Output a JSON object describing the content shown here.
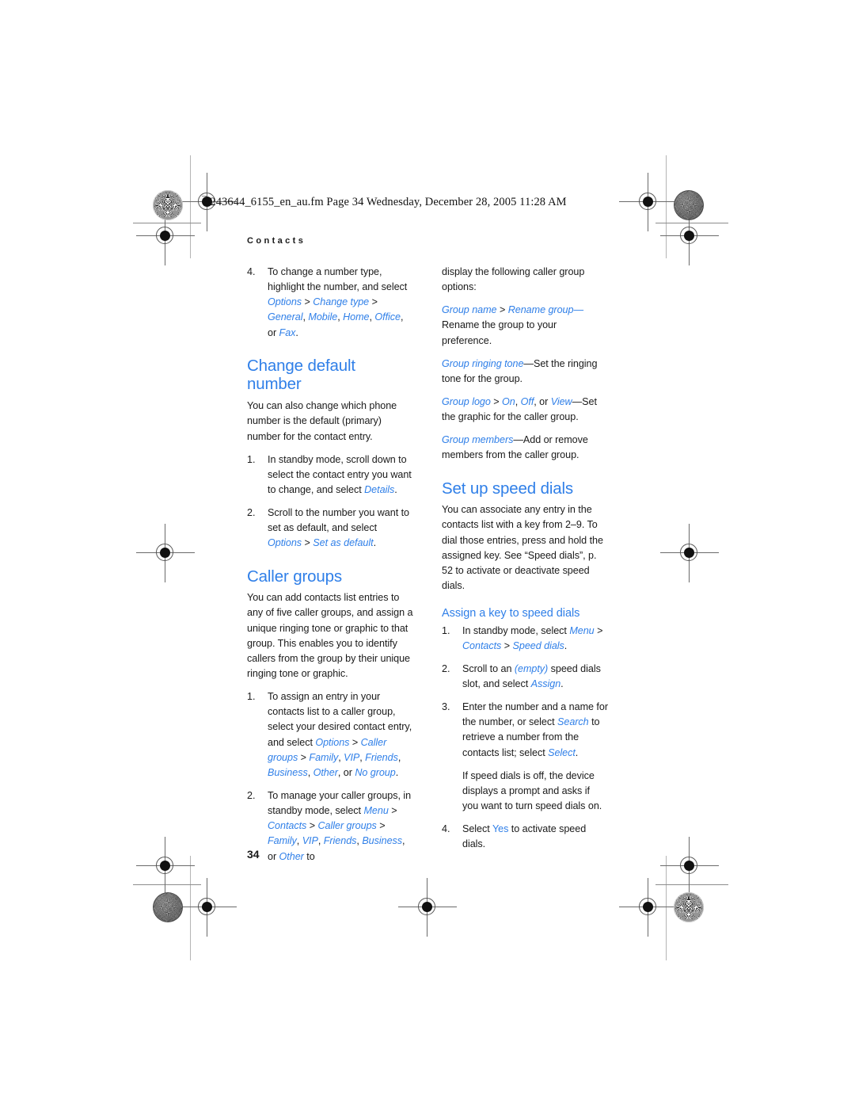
{
  "page": {
    "filename_line": "9243644_6155_en_au.fm  Page 34  Wednesday, December 28, 2005  11:28 AM",
    "running_head": "Contacts",
    "page_number": "34",
    "accent_color": "#2f7fe8",
    "text_color": "#1a1a1a"
  },
  "left_column": {
    "step4": {
      "num": "4.",
      "t1": "To change a number type, highlight the number, and select ",
      "ui1": "Options",
      "sep1": " > ",
      "ui2": "Change type",
      "sep2": " > ",
      "ui3": "General",
      "c1": ", ",
      "ui4": "Mobile",
      "c2": ", ",
      "ui5": "Home",
      "c3": ", ",
      "ui6": "Office",
      "c4": ", or ",
      "ui7": "Fax",
      "end": "."
    },
    "heading_change_default": "Change default number",
    "change_default_intro": "You can also change which phone number is the default (primary) number for the contact entry.",
    "cd_step1": {
      "num": "1.",
      "t1": "In standby mode, scroll down to select the contact entry you want to change, and select ",
      "ui1": "Details",
      "end": "."
    },
    "cd_step2": {
      "num": "2.",
      "t1": "Scroll to the number you want to set as default, and select ",
      "ui1": "Options",
      "sep1": " > ",
      "ui2": "Set as default",
      "end": "."
    },
    "heading_caller_groups": "Caller groups",
    "caller_groups_intro": "You can add contacts list entries to any of five caller groups, and assign a unique ringing tone or graphic to that group. This enables you to identify callers from the group by their unique ringing tone or graphic.",
    "cg_step1": {
      "num": "1.",
      "t1": "To assign an entry in your contacts list to a caller group, select your desired contact entry, and select ",
      "ui1": "Options",
      "sep1": " > ",
      "ui2": "Caller groups",
      "sep2": " > ",
      "ui3": "Family",
      "c1": ", ",
      "ui4": "VIP",
      "c2": ", ",
      "ui5": "Friends",
      "c3": ", ",
      "ui6": "Business",
      "c4": ", ",
      "ui7": "Other",
      "c5": ", or ",
      "ui8": "No group",
      "end": "."
    },
    "cg_step2": {
      "num": "2.",
      "t1": "To manage your caller groups, in standby mode, select ",
      "ui1": "Menu",
      "sep1": " > ",
      "ui2": "Contacts",
      "sep2": " > ",
      "ui3": "Caller groups",
      "sep3": " > ",
      "ui4": "Family",
      "c1": ", ",
      "ui5": "VIP",
      "c2": ", ",
      "ui6": "Friends",
      "c3": ", ",
      "ui7": "Business",
      "c4": ", or ",
      "ui8": "Other",
      "end": " to"
    }
  },
  "right_column": {
    "continuation": "display the following caller group options:",
    "opt_group_name": {
      "ui1": "Group name",
      "sep1": " > ",
      "ui2": "Rename group",
      "dash": "—",
      "t1": "Rename the group to your preference."
    },
    "opt_group_ringing_tone": {
      "ui1": "Group ringing tone",
      "dash": "—",
      "t1": "Set the ringing tone for the group."
    },
    "opt_group_logo": {
      "ui1": "Group logo",
      "sep1": " > ",
      "ui2": "On",
      "c1": ", ",
      "ui3": "Off",
      "c2": ", or ",
      "ui4": "View",
      "dash": "—",
      "t1": "Set the graphic for the caller group."
    },
    "opt_group_members": {
      "ui1": "Group members",
      "dash": "—",
      "t1": "Add or remove members from the caller group."
    },
    "heading_speed_dials": "Set up speed dials",
    "speed_dials_intro": "You can associate any entry in the contacts list with a key from 2–9. To dial those entries, press and hold the assigned key. See “Speed dials”, p. 52 to activate or deactivate speed dials.",
    "subheading_assign_key": "Assign a key to speed dials",
    "ak_step1": {
      "num": "1.",
      "t1": "In standby mode, select ",
      "ui1": "Menu",
      "sep1": " > ",
      "ui2": "Contacts",
      "sep2": " > ",
      "ui3": "Speed dials",
      "end": "."
    },
    "ak_step2": {
      "num": "2.",
      "t1": "Scroll to an ",
      "ui1": "(empty)",
      "t2": " speed dials slot, and select ",
      "ui2": "Assign",
      "end": "."
    },
    "ak_step3": {
      "num": "3.",
      "t1": "Enter the number and a name for the number, or select ",
      "ui1": "Search",
      "t2": " to retrieve a number from the contacts list; select ",
      "ui2": "Select",
      "end": "."
    },
    "ak_note": "If speed dials is off, the device displays a prompt and asks if you want to turn speed dials on.",
    "ak_step4": {
      "num": "4.",
      "t1": "Select ",
      "ui1": "Yes",
      "t2": " to activate speed dials."
    }
  }
}
